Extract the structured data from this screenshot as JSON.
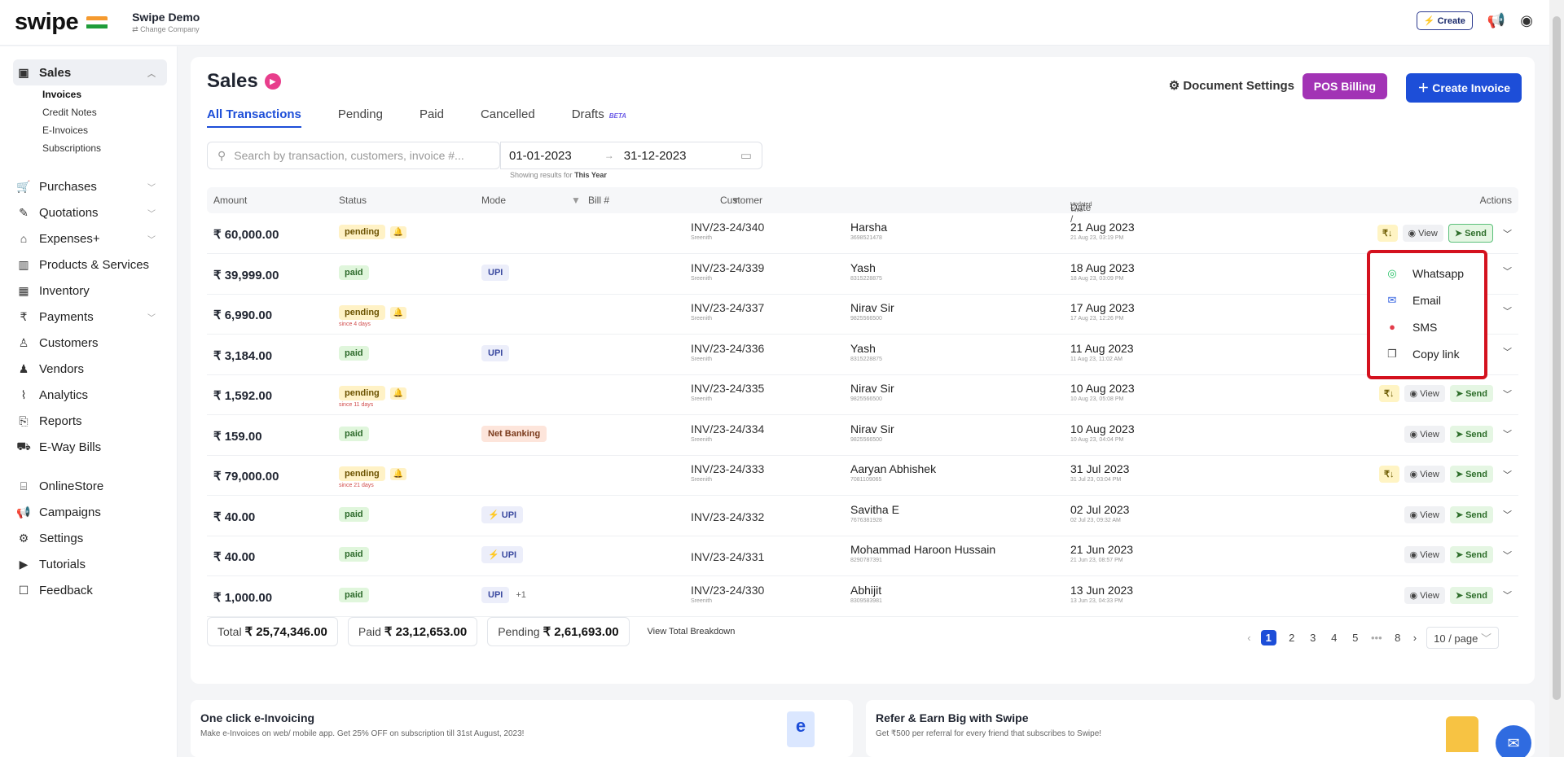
{
  "topbar": {
    "logo": "swipe",
    "company_name": "Swipe Demo",
    "change_company": "⇄ Change Company",
    "create_label": "⚡ Create"
  },
  "sidebar": {
    "sales": "Sales",
    "sales_sub": [
      "Invoices",
      "Credit Notes",
      "E-Invoices",
      "Subscriptions"
    ],
    "items": [
      {
        "label": "Purchases",
        "icon": "cart-icon"
      },
      {
        "label": "Quotations",
        "icon": "pen-icon"
      },
      {
        "label": "Expenses+",
        "icon": "tag-icon"
      },
      {
        "label": "Products & Services",
        "icon": "barcode-icon"
      },
      {
        "label": "Inventory",
        "icon": "warehouse-icon"
      },
      {
        "label": "Payments",
        "icon": "rupee-icon"
      },
      {
        "label": "Customers",
        "icon": "user-icon"
      },
      {
        "label": "Vendors",
        "icon": "users-icon"
      },
      {
        "label": "Analytics",
        "icon": "chart-icon"
      },
      {
        "label": "Reports",
        "icon": "report-icon"
      },
      {
        "label": "E-Way Bills",
        "icon": "truck-icon"
      },
      {
        "label": "OnlineStore",
        "icon": "store-icon"
      },
      {
        "label": "Campaigns",
        "icon": "megaphone-icon"
      },
      {
        "label": "Settings",
        "icon": "gear-icon"
      },
      {
        "label": "Tutorials",
        "icon": "youtube-icon"
      },
      {
        "label": "Feedback",
        "icon": "chat-icon"
      }
    ]
  },
  "page": {
    "title": "Sales",
    "tabs": [
      "All Transactions",
      "Pending",
      "Paid",
      "Cancelled",
      "Drafts"
    ],
    "beta": "BETA",
    "doc_settings": "Document Settings",
    "pos_billing": "POS Billing",
    "create_invoice": "Create Invoice",
    "search_placeholder": "Search by transaction, customers, invoice #...",
    "date_from": "01-01-2023",
    "date_to": "31-12-2023",
    "showing": "Showing results for",
    "showing_period": "This Year"
  },
  "table": {
    "headers": {
      "amount": "Amount",
      "status": "Status",
      "mode": "Mode",
      "bill": "Bill #",
      "customer": "Customer",
      "date": "Date /",
      "date_sub": "Updated Time",
      "actions": "Actions"
    },
    "view": "View",
    "send": "Send",
    "rows": [
      {
        "amount": "₹ 60,000.00",
        "status": "pending",
        "since": "",
        "mode": "",
        "mode_extra": "",
        "bill": "INV/23-24/340",
        "bill_sub": "Sreenith",
        "customer": "Harsha",
        "phone": "3698521478",
        "date": "21 Aug 2023",
        "time": "21 Aug 23, 03:19 PM",
        "rs": true
      },
      {
        "amount": "₹ 39,999.00",
        "status": "paid",
        "since": "",
        "mode": "UPI",
        "mode_extra": "",
        "bill": "INV/23-24/339",
        "bill_sub": "Sreenith",
        "customer": "Yash",
        "phone": "8315228875",
        "date": "18 Aug 2023",
        "time": "18 Aug 23, 03:09 PM",
        "rs": false
      },
      {
        "amount": "₹ 6,990.00",
        "status": "pending",
        "since": "since 4 days",
        "mode": "",
        "mode_extra": "",
        "bill": "INV/23-24/337",
        "bill_sub": "Sreenith",
        "customer": "Nirav Sir",
        "phone": "9825566500",
        "date": "17 Aug 2023",
        "time": "17 Aug 23, 12:26 PM",
        "rs": false
      },
      {
        "amount": "₹ 3,184.00",
        "status": "paid",
        "since": "",
        "mode": "UPI",
        "mode_extra": "",
        "bill": "INV/23-24/336",
        "bill_sub": "Sreenith",
        "customer": "Yash",
        "phone": "8315228875",
        "date": "11 Aug 2023",
        "time": "11 Aug 23, 11:02 AM",
        "rs": false
      },
      {
        "amount": "₹ 1,592.00",
        "status": "pending",
        "since": "since 11 days",
        "mode": "",
        "mode_extra": "",
        "bill": "INV/23-24/335",
        "bill_sub": "Sreenith",
        "customer": "Nirav Sir",
        "phone": "9825566500",
        "date": "10 Aug 2023",
        "time": "10 Aug 23, 05:08 PM",
        "rs": true
      },
      {
        "amount": "₹ 159.00",
        "status": "paid",
        "since": "",
        "mode": "Net Banking",
        "mode_extra": "",
        "bill": "INV/23-24/334",
        "bill_sub": "Sreenith",
        "customer": "Nirav Sir",
        "phone": "9825566500",
        "date": "10 Aug 2023",
        "time": "10 Aug 23, 04:04 PM",
        "rs": false
      },
      {
        "amount": "₹ 79,000.00",
        "status": "pending",
        "since": "since 21 days",
        "mode": "",
        "mode_extra": "",
        "bill": "INV/23-24/333",
        "bill_sub": "Sreenith",
        "customer": "Aaryan Abhishek",
        "phone": "7081109065",
        "date": "31 Jul 2023",
        "time": "31 Jul 23, 03:04 PM",
        "rs": true
      },
      {
        "amount": "₹ 40.00",
        "status": "paid",
        "since": "",
        "mode": "⚡ UPI",
        "mode_extra": "",
        "bill": "INV/23-24/332",
        "bill_sub": "",
        "customer": "Savitha E",
        "phone": "7676381928",
        "date": "02 Jul 2023",
        "time": "02 Jul 23, 09:32 AM",
        "rs": false
      },
      {
        "amount": "₹ 40.00",
        "status": "paid",
        "since": "",
        "mode": "⚡ UPI",
        "mode_extra": "",
        "bill": "INV/23-24/331",
        "bill_sub": "",
        "customer": "Mohammad Haroon Hussain",
        "phone": "8290787391",
        "date": "21 Jun 2023",
        "time": "21 Jun 23, 08:57 PM",
        "rs": false
      },
      {
        "amount": "₹ 1,000.00",
        "status": "paid",
        "since": "",
        "mode": "UPI",
        "mode_extra": "+1",
        "bill": "INV/23-24/330",
        "bill_sub": "Sreenith",
        "customer": "Abhijit",
        "phone": "8309583981",
        "date": "13 Jun 2023",
        "time": "13 Jun 23, 04:33 PM",
        "rs": false
      }
    ]
  },
  "dropdown": {
    "items": [
      {
        "label": "Whatsapp",
        "icon": "whatsapp-icon"
      },
      {
        "label": "Email",
        "icon": "email-icon"
      },
      {
        "label": "SMS",
        "icon": "sms-icon"
      },
      {
        "label": "Copy link",
        "icon": "copy-link-icon"
      }
    ]
  },
  "totals": {
    "total_label": "Total",
    "total": "₹ 25,74,346.00",
    "paid_label": "Paid",
    "paid": "₹ 23,12,653.00",
    "pending_label": "Pending",
    "pending": "₹ 2,61,693.00",
    "breakdown": "View Total Breakdown"
  },
  "pager": {
    "pages": [
      "1",
      "2",
      "3",
      "4",
      "5",
      "•••",
      "8"
    ],
    "current": "1",
    "size": "10 / page"
  },
  "promos": [
    {
      "title": "One click e-Invoicing",
      "text": "Make e-Invoices on web/ mobile app. Get 25% OFF on subscription till 31st August, 2023!"
    },
    {
      "title": "Refer & Earn Big with Swipe",
      "text": "Get ₹500 per referral for every friend that subscribes to Swipe!"
    }
  ],
  "colors": {
    "primary": "#1d4ed8",
    "pos": "#a233b5",
    "highlight": "#d4111e"
  }
}
